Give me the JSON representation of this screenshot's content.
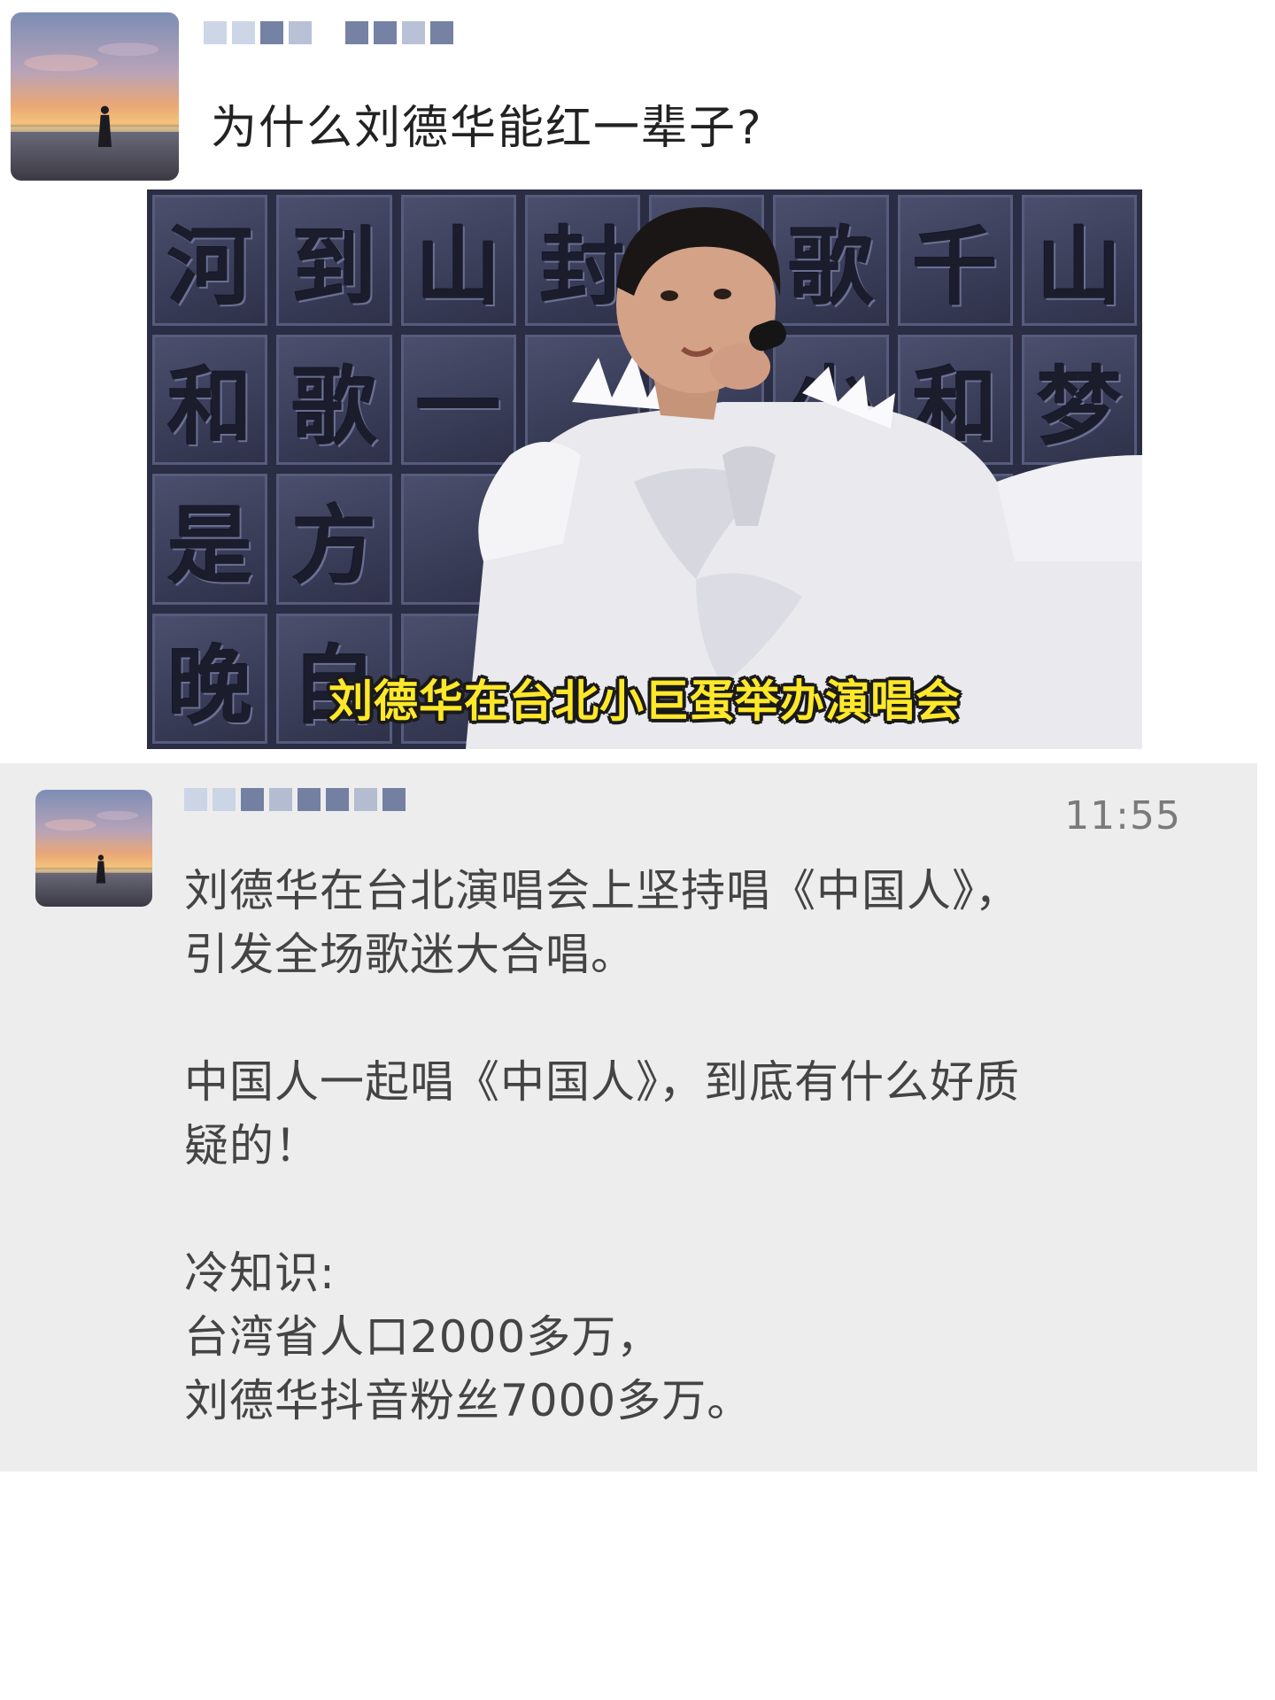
{
  "post1": {
    "question": "为什么刘德华能红一辈子?",
    "image_caption": "刘德华在台北小巨蛋举办演唱会",
    "background_wall_chars": [
      "河",
      "到",
      "山",
      "封",
      "",
      "歌",
      "千",
      "山",
      "和",
      "歌",
      "一",
      "",
      "",
      "少",
      "和",
      "梦",
      "是",
      "方",
      "",
      "",
      "",
      "",
      "",
      "",
      "晚",
      "自",
      "",
      "",
      "",
      "",
      "",
      ""
    ]
  },
  "post2": {
    "timestamp": "11:55",
    "paragraphs": [
      [
        "刘德华在台北演唱会上坚持唱《中国人》，",
        "引发全场歌迷大合唱。"
      ],
      [
        "中国人一起唱《中国人》，到底有什么好质",
        "疑的！"
      ],
      [
        "冷知识:",
        "台湾省人口2000多万，",
        "刘德华抖音粉丝7000多万。"
      ]
    ]
  },
  "colors": {
    "caption_yellow": "#ffe82a",
    "post2_background": "#ededed",
    "timestamp_gray": "#7a7a7a"
  },
  "icons": {
    "avatar": "sunset-beach-avatar-icon"
  }
}
